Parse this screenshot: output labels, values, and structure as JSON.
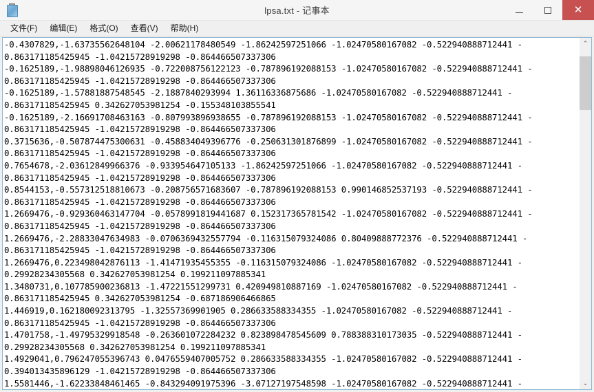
{
  "window": {
    "title": "lpsa.txt - 记事本",
    "app_icon": "notepad-icon",
    "controls": {
      "minimize_label": "",
      "maximize_label": "",
      "close_label": "✕"
    }
  },
  "menubar": {
    "items": [
      {
        "label": "文件(F)",
        "name": "menu-file"
      },
      {
        "label": "编辑(E)",
        "name": "menu-edit"
      },
      {
        "label": "格式(O)",
        "name": "menu-format"
      },
      {
        "label": "查看(V)",
        "name": "menu-view"
      },
      {
        "label": "帮助(H)",
        "name": "menu-help"
      }
    ]
  },
  "editor": {
    "lines": [
      "-0.4307829,-1.63735562648104 -2.00621178480549 -1.86242597251066 -1.02470580167082 -0.522940888712441 -",
      "0.863171185425945 -1.04215728919298 -0.864466507337306",
      "-0.1625189,-1.98898046126935 -0.722008756122123 -0.787896192088153 -1.02470580167082 -0.522940888712441 -",
      "0.863171185425945 -1.04215728919298 -0.864466507337306",
      "-0.1625189,-1.57881887548545 -2.1887840293994 1.36116336875686 -1.02470580167082 -0.522940888712441 -",
      "0.863171185425945 0.342627053981254 -0.155348103855541",
      "-0.1625189,-2.16691708463163 -0.807993896938655 -0.787896192088153 -1.02470580167082 -0.522940888712441 -",
      "0.863171185425945 -1.04215728919298 -0.864466507337306",
      "0.3715636,-0.507874475300631 -0.458834049396776 -0.250631301876899 -1.02470580167082 -0.522940888712441 -",
      "0.863171185425945 -1.04215728919298 -0.864466507337306",
      "0.7654678,-2.03612849966376 -0.933954647105133 -1.86242597251066 -1.02470580167082 -0.522940888712441 -",
      "0.863171185425945 -1.04215728919298 -0.864466507337306",
      "0.8544153,-0.557312518810673 -0.208756571683607 -0.787896192088153 0.990146852537193 -0.522940888712441 -",
      "0.863171185425945 -1.04215728919298 -0.864466507337306",
      "1.2669476,-0.929360463147704 -0.0578991819441687 0.152317365781542 -1.02470580167082 -0.522940888712441 -",
      "0.863171185425945 -1.04215728919298 -0.864466507337306",
      "1.2669476,-2.28833047634983 -0.0706369432557794 -0.116315079324086 0.80409888772376 -0.522940888712441 -",
      "0.863171185425945 -1.04215728919298 -0.864466507337306",
      "1.2669476,0.223498042876113 -1.41471935455355 -0.116315079324086 -1.02470580167082 -0.522940888712441 -",
      "0.29928234305568 0.342627053981254 0.199211097885341",
      "1.3480731,0.107785900236813 -1.47221551299731 0.420949810887169 -1.02470580167082 -0.522940888712441 -",
      "0.863171185425945 0.342627053981254 -0.687186906466865",
      "1.446919,0.162180092313795 -1.32557369901905 0.286633588334355 -1.02470580167082 -0.522940888712441 -",
      "0.863171185425945 -1.04215728919298 -0.864466507337306",
      "1.4701758,-1.49795329918548 -0.263601072284232 0.823898478545609 0.788388310173035 -0.522940888712441 -",
      "0.29928234305568 0.342627053981254 0.199211097885341",
      "1.4929041,0.796247055396743 0.0476559407005752 0.286633588334355 -1.02470580167082 -0.522940888712441 -",
      "0.394013435896129 -1.04215728919298 -0.864466507337306",
      "1.5581446,-1.62233848461465 -0.843294091975396 -3.07127197548598 -1.02470580167082 -0.522940888712441 -"
    ]
  },
  "scrollbar": {
    "up_arrow": "⌃",
    "down_arrow": "⌄",
    "thumb_name": "scrollbar-thumb"
  },
  "colors": {
    "close_button": "#c75050",
    "editor_border": "#8fb8d4",
    "scrollbar_thumb": "#cdcdcd"
  }
}
